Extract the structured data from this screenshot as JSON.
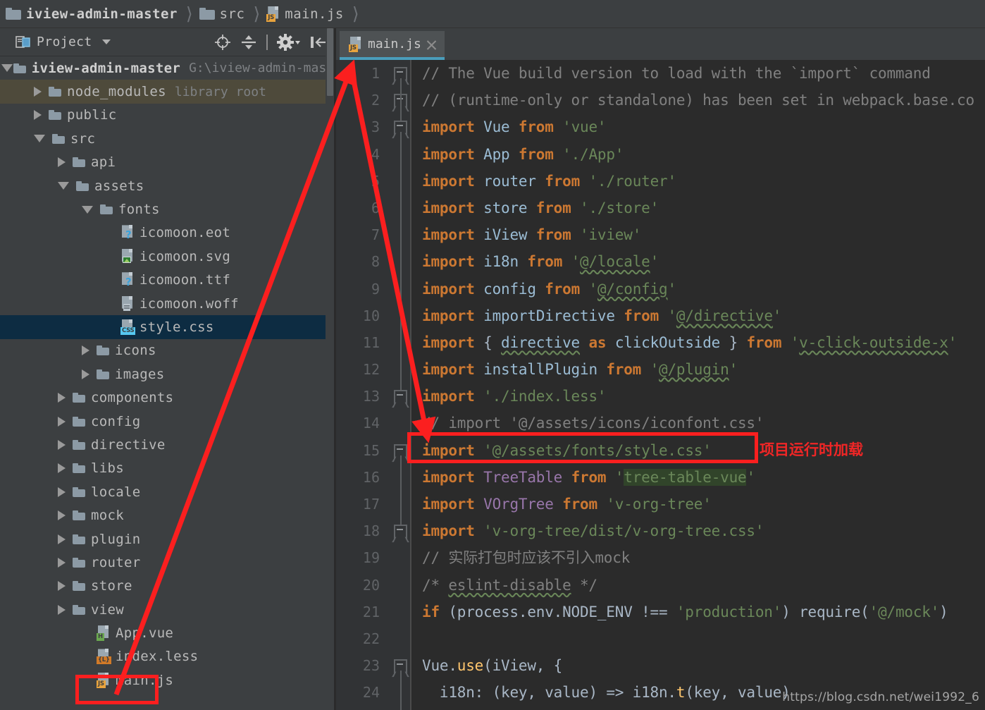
{
  "breadcrumb": {
    "items": [
      {
        "label": "iview-admin-master",
        "icon": "folder-icon",
        "bold": true
      },
      {
        "label": "src",
        "icon": "folder-icon",
        "bold": false
      },
      {
        "label": "main.js",
        "icon": "js-file-icon",
        "bold": false
      }
    ]
  },
  "project_panel": {
    "title": "Project",
    "tools": [
      {
        "name": "locate-icon"
      },
      {
        "name": "collapse-all-icon"
      },
      {
        "name": "settings-gear-icon"
      },
      {
        "name": "hide-panel-icon"
      }
    ],
    "tree": [
      {
        "label": "iview-admin-master",
        "sub": "G:\\iview-admin-mast",
        "depth": 0,
        "twisty": "open",
        "icon": "folder-icon",
        "bold": true,
        "highlight": "none"
      },
      {
        "label": "node_modules",
        "sub": "library root",
        "depth": 1,
        "twisty": "closed",
        "icon": "folder-icon",
        "bold": false,
        "highlight": "olive"
      },
      {
        "label": "public",
        "sub": "",
        "depth": 1,
        "twisty": "closed",
        "icon": "folder-icon",
        "bold": false,
        "highlight": "none"
      },
      {
        "label": "src",
        "sub": "",
        "depth": 1,
        "twisty": "open",
        "icon": "folder-icon",
        "bold": false,
        "highlight": "none"
      },
      {
        "label": "api",
        "sub": "",
        "depth": 2,
        "twisty": "closed",
        "icon": "folder-icon",
        "bold": false,
        "highlight": "none"
      },
      {
        "label": "assets",
        "sub": "",
        "depth": 2,
        "twisty": "open",
        "icon": "folder-icon",
        "bold": false,
        "highlight": "none"
      },
      {
        "label": "fonts",
        "sub": "",
        "depth": 3,
        "twisty": "open",
        "icon": "folder-icon",
        "bold": false,
        "highlight": "none"
      },
      {
        "label": "icomoon.eot",
        "sub": "",
        "depth": 4,
        "twisty": "none",
        "icon": "unknown-file-icon",
        "bold": false,
        "highlight": "none"
      },
      {
        "label": "icomoon.svg",
        "sub": "",
        "depth": 4,
        "twisty": "none",
        "icon": "image-file-icon",
        "bold": false,
        "highlight": "none"
      },
      {
        "label": "icomoon.ttf",
        "sub": "",
        "depth": 4,
        "twisty": "none",
        "icon": "unknown-file-icon",
        "bold": false,
        "highlight": "none"
      },
      {
        "label": "icomoon.woff",
        "sub": "",
        "depth": 4,
        "twisty": "none",
        "icon": "text-file-icon",
        "bold": false,
        "highlight": "none"
      },
      {
        "label": "style.css",
        "sub": "",
        "depth": 4,
        "twisty": "none",
        "icon": "css-file-icon",
        "bold": false,
        "highlight": "blue"
      },
      {
        "label": "icons",
        "sub": "",
        "depth": 3,
        "twisty": "closed",
        "icon": "folder-icon",
        "bold": false,
        "highlight": "none"
      },
      {
        "label": "images",
        "sub": "",
        "depth": 3,
        "twisty": "closed",
        "icon": "folder-icon",
        "bold": false,
        "highlight": "none"
      },
      {
        "label": "components",
        "sub": "",
        "depth": 2,
        "twisty": "closed",
        "icon": "folder-icon",
        "bold": false,
        "highlight": "none"
      },
      {
        "label": "config",
        "sub": "",
        "depth": 2,
        "twisty": "closed",
        "icon": "folder-icon",
        "bold": false,
        "highlight": "none"
      },
      {
        "label": "directive",
        "sub": "",
        "depth": 2,
        "twisty": "closed",
        "icon": "folder-icon",
        "bold": false,
        "highlight": "none"
      },
      {
        "label": "libs",
        "sub": "",
        "depth": 2,
        "twisty": "closed",
        "icon": "folder-icon",
        "bold": false,
        "highlight": "none"
      },
      {
        "label": "locale",
        "sub": "",
        "depth": 2,
        "twisty": "closed",
        "icon": "folder-icon",
        "bold": false,
        "highlight": "none"
      },
      {
        "label": "mock",
        "sub": "",
        "depth": 2,
        "twisty": "closed",
        "icon": "folder-icon",
        "bold": false,
        "highlight": "none"
      },
      {
        "label": "plugin",
        "sub": "",
        "depth": 2,
        "twisty": "closed",
        "icon": "folder-icon",
        "bold": false,
        "highlight": "none"
      },
      {
        "label": "router",
        "sub": "",
        "depth": 2,
        "twisty": "closed",
        "icon": "folder-icon",
        "bold": false,
        "highlight": "none"
      },
      {
        "label": "store",
        "sub": "",
        "depth": 2,
        "twisty": "closed",
        "icon": "folder-icon",
        "bold": false,
        "highlight": "none"
      },
      {
        "label": "view",
        "sub": "",
        "depth": 2,
        "twisty": "closed",
        "icon": "folder-icon",
        "bold": false,
        "highlight": "none"
      },
      {
        "label": "App.vue",
        "sub": "",
        "depth": 3,
        "twisty": "none",
        "icon": "vue-file-icon",
        "bold": false,
        "highlight": "none"
      },
      {
        "label": "index.less",
        "sub": "",
        "depth": 3,
        "twisty": "none",
        "icon": "less-file-icon",
        "bold": false,
        "highlight": "none"
      },
      {
        "label": "main.js",
        "sub": "",
        "depth": 3,
        "twisty": "none",
        "icon": "js-file-icon",
        "bold": false,
        "highlight": "none"
      }
    ]
  },
  "editor": {
    "tab": {
      "label": "main.js",
      "icon": "js-file-icon",
      "close_icon": "close-icon",
      "active": true
    },
    "lines": [
      {
        "n": "1",
        "fold": "start",
        "tokens": [
          {
            "t": "// The Vue build version to load with the `import` command",
            "c": "cmt"
          }
        ]
      },
      {
        "n": "2",
        "fold": "end",
        "tokens": [
          {
            "t": "// (runtime-only or standalone) has been set in webpack.base.co",
            "c": "cmt"
          }
        ]
      },
      {
        "n": "3",
        "fold": "start",
        "tokens": [
          {
            "t": "import",
            "c": "kw"
          },
          {
            "t": " ",
            "c": "plain"
          },
          {
            "t": "Vue",
            "c": "id"
          },
          {
            "t": " ",
            "c": "plain"
          },
          {
            "t": "from",
            "c": "kw"
          },
          {
            "t": " ",
            "c": "plain"
          },
          {
            "t": "'vue'",
            "c": "str"
          }
        ]
      },
      {
        "n": "4",
        "fold": "none",
        "tokens": [
          {
            "t": "import",
            "c": "kw"
          },
          {
            "t": " ",
            "c": "plain"
          },
          {
            "t": "App",
            "c": "id"
          },
          {
            "t": " ",
            "c": "plain"
          },
          {
            "t": "from",
            "c": "kw"
          },
          {
            "t": " ",
            "c": "plain"
          },
          {
            "t": "'./App'",
            "c": "str"
          }
        ]
      },
      {
        "n": "5",
        "fold": "none",
        "tokens": [
          {
            "t": "import",
            "c": "kw"
          },
          {
            "t": " ",
            "c": "plain"
          },
          {
            "t": "router",
            "c": "id"
          },
          {
            "t": " ",
            "c": "plain"
          },
          {
            "t": "from",
            "c": "kw"
          },
          {
            "t": " ",
            "c": "plain"
          },
          {
            "t": "'./router'",
            "c": "str"
          }
        ]
      },
      {
        "n": "6",
        "fold": "none",
        "tokens": [
          {
            "t": "import",
            "c": "kw"
          },
          {
            "t": " ",
            "c": "plain"
          },
          {
            "t": "store",
            "c": "id"
          },
          {
            "t": " ",
            "c": "plain"
          },
          {
            "t": "from",
            "c": "kw"
          },
          {
            "t": " ",
            "c": "plain"
          },
          {
            "t": "'./store'",
            "c": "str"
          }
        ]
      },
      {
        "n": "7",
        "fold": "none",
        "tokens": [
          {
            "t": "import",
            "c": "kw"
          },
          {
            "t": " ",
            "c": "plain"
          },
          {
            "t": "iView",
            "c": "id"
          },
          {
            "t": " ",
            "c": "plain"
          },
          {
            "t": "from",
            "c": "kw"
          },
          {
            "t": " ",
            "c": "plain"
          },
          {
            "t": "'iview'",
            "c": "str"
          }
        ]
      },
      {
        "n": "8",
        "fold": "none",
        "tokens": [
          {
            "t": "import",
            "c": "kw"
          },
          {
            "t": " ",
            "c": "plain"
          },
          {
            "t": "i18n",
            "c": "id"
          },
          {
            "t": " ",
            "c": "plain"
          },
          {
            "t": "from",
            "c": "kw"
          },
          {
            "t": " ",
            "c": "plain"
          },
          {
            "t": "'",
            "c": "str"
          },
          {
            "t": "@/locale",
            "c": "str wavy"
          },
          {
            "t": "'",
            "c": "str"
          }
        ]
      },
      {
        "n": "9",
        "fold": "none",
        "tokens": [
          {
            "t": "import",
            "c": "kw"
          },
          {
            "t": " ",
            "c": "plain"
          },
          {
            "t": "config",
            "c": "id"
          },
          {
            "t": " ",
            "c": "plain"
          },
          {
            "t": "from",
            "c": "kw"
          },
          {
            "t": " ",
            "c": "plain"
          },
          {
            "t": "'",
            "c": "str"
          },
          {
            "t": "@/config",
            "c": "str wavy"
          },
          {
            "t": "'",
            "c": "str"
          }
        ]
      },
      {
        "n": "10",
        "fold": "none",
        "tokens": [
          {
            "t": "import",
            "c": "kw"
          },
          {
            "t": " ",
            "c": "plain"
          },
          {
            "t": "importDirective",
            "c": "id"
          },
          {
            "t": " ",
            "c": "plain"
          },
          {
            "t": "from",
            "c": "kw"
          },
          {
            "t": " ",
            "c": "plain"
          },
          {
            "t": "'",
            "c": "str"
          },
          {
            "t": "@/directive",
            "c": "str wavy"
          },
          {
            "t": "'",
            "c": "str"
          }
        ]
      },
      {
        "n": "11",
        "fold": "none",
        "tokens": [
          {
            "t": "import",
            "c": "kw"
          },
          {
            "t": " { ",
            "c": "plain"
          },
          {
            "t": "directive",
            "c": "id wavy"
          },
          {
            "t": " ",
            "c": "plain"
          },
          {
            "t": "as",
            "c": "kw"
          },
          {
            "t": " ",
            "c": "plain"
          },
          {
            "t": "clickOutside",
            "c": "id"
          },
          {
            "t": " } ",
            "c": "plain"
          },
          {
            "t": "from",
            "c": "kw"
          },
          {
            "t": " ",
            "c": "plain"
          },
          {
            "t": "'",
            "c": "str"
          },
          {
            "t": "v-click-outside-x",
            "c": "str wavy"
          },
          {
            "t": "'",
            "c": "str"
          }
        ]
      },
      {
        "n": "12",
        "fold": "none",
        "tokens": [
          {
            "t": "import",
            "c": "kw"
          },
          {
            "t": " ",
            "c": "plain"
          },
          {
            "t": "installPlugin",
            "c": "id"
          },
          {
            "t": " ",
            "c": "plain"
          },
          {
            "t": "from",
            "c": "kw"
          },
          {
            "t": " ",
            "c": "plain"
          },
          {
            "t": "'",
            "c": "str"
          },
          {
            "t": "@/plugin",
            "c": "str wavy"
          },
          {
            "t": "'",
            "c": "str"
          }
        ]
      },
      {
        "n": "13",
        "fold": "start",
        "tokens": [
          {
            "t": "import",
            "c": "kw"
          },
          {
            "t": " ",
            "c": "plain"
          },
          {
            "t": "'./index.less'",
            "c": "str"
          }
        ]
      },
      {
        "n": "14",
        "fold": "none",
        "tokens": [
          {
            "t": "// import '@/assets/icons/iconfont.css'",
            "c": "cmt"
          }
        ]
      },
      {
        "n": "15",
        "fold": "start",
        "tokens": [
          {
            "t": "import",
            "c": "kw"
          },
          {
            "t": " ",
            "c": "plain"
          },
          {
            "t": "'@/assets/fonts/style.css'",
            "c": "str"
          }
        ]
      },
      {
        "n": "16",
        "fold": "none",
        "tokens": [
          {
            "t": "import",
            "c": "kw"
          },
          {
            "t": " ",
            "c": "plain"
          },
          {
            "t": "TreeTable",
            "c": "cls"
          },
          {
            "t": " ",
            "c": "plain"
          },
          {
            "t": "from",
            "c": "kw"
          },
          {
            "t": " ",
            "c": "plain"
          },
          {
            "t": "'",
            "c": "str"
          },
          {
            "t": "tree-table-vue",
            "c": "str strhl"
          },
          {
            "t": "'",
            "c": "str"
          }
        ]
      },
      {
        "n": "17",
        "fold": "none",
        "tokens": [
          {
            "t": "import",
            "c": "kw"
          },
          {
            "t": " ",
            "c": "plain"
          },
          {
            "t": "VOrgTree",
            "c": "cls"
          },
          {
            "t": " ",
            "c": "plain"
          },
          {
            "t": "from",
            "c": "kw"
          },
          {
            "t": " ",
            "c": "plain"
          },
          {
            "t": "'v-org-tree'",
            "c": "str"
          }
        ]
      },
      {
        "n": "18",
        "fold": "end",
        "tokens": [
          {
            "t": "import",
            "c": "kw"
          },
          {
            "t": " ",
            "c": "plain"
          },
          {
            "t": "'v-org-tree/dist/v-org-tree.css'",
            "c": "str"
          }
        ]
      },
      {
        "n": "19",
        "fold": "none",
        "tokens": [
          {
            "t": "// 实际打包时应该不引入mock",
            "c": "cmt"
          }
        ]
      },
      {
        "n": "20",
        "fold": "none",
        "tokens": [
          {
            "t": "/* ",
            "c": "cmt"
          },
          {
            "t": "eslint-disable",
            "c": "cmt wavy"
          },
          {
            "t": " */",
            "c": "cmt"
          }
        ]
      },
      {
        "n": "21",
        "fold": "none",
        "tokens": [
          {
            "t": "if",
            "c": "kw"
          },
          {
            "t": " (process.env.NODE_ENV !== ",
            "c": "plain"
          },
          {
            "t": "'production'",
            "c": "str"
          },
          {
            "t": ") require(",
            "c": "plain"
          },
          {
            "t": "'@/mock'",
            "c": "str"
          },
          {
            "t": ")",
            "c": "plain"
          }
        ]
      },
      {
        "n": "22",
        "fold": "none",
        "tokens": [
          {
            "t": "",
            "c": "plain"
          }
        ]
      },
      {
        "n": "23",
        "fold": "start",
        "tokens": [
          {
            "t": "Vue.",
            "c": "plain"
          },
          {
            "t": "use",
            "c": "fn"
          },
          {
            "t": "(iView, {",
            "c": "plain"
          }
        ]
      },
      {
        "n": "24",
        "fold": "none",
        "tokens": [
          {
            "t": "  i18n",
            "c": "plain"
          },
          {
            "t": ":",
            "c": "plain"
          },
          {
            "t": " (key, value) => i18n.",
            "c": "plain"
          },
          {
            "t": "t",
            "c": "fn"
          },
          {
            "t": "(key, value)",
            "c": "plain"
          }
        ]
      }
    ]
  },
  "annotations": {
    "code_note": "项目运行时加载",
    "box_color": "#fb1f1f",
    "arrows": [
      {
        "name": "arrow-to-editor-tab"
      },
      {
        "name": "arrow-to-import-line"
      }
    ]
  },
  "watermark": "https://blog.csdn.net/wei1992_6"
}
